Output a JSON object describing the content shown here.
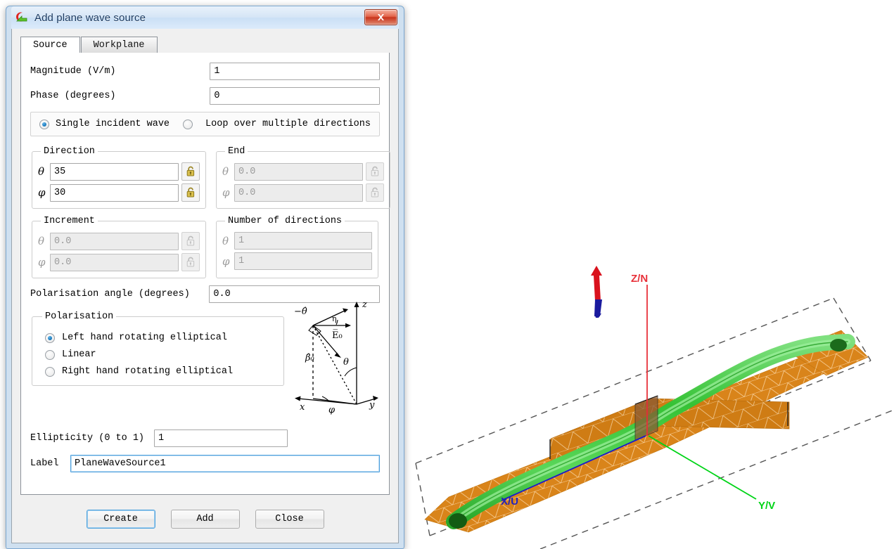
{
  "window": {
    "title": "Add plane wave source",
    "icon": "app-icon",
    "close_label": "close-icon"
  },
  "tabs": [
    {
      "label": "Source",
      "active": true
    },
    {
      "label": "Workplane",
      "active": false
    }
  ],
  "source": {
    "magnitude": {
      "label": "Magnitude (V/m)",
      "value": "1"
    },
    "phase": {
      "label": "Phase (degrees)",
      "value": "0"
    },
    "wave_mode": {
      "single": {
        "label": "Single incident wave",
        "selected": true
      },
      "loop": {
        "label": "Loop over multiple directions",
        "selected": false
      }
    },
    "direction": {
      "legend": "Direction",
      "theta_symbol": "θ",
      "phi_symbol": "φ",
      "theta": "35",
      "phi": "30",
      "lock_icon": "unlock-icon",
      "enabled": true
    },
    "end": {
      "legend": "End",
      "theta_symbol": "θ",
      "phi_symbol": "φ",
      "theta": "0.0",
      "phi": "0.0",
      "lock_icon": "unlock-icon",
      "enabled": false
    },
    "increment": {
      "legend": "Increment",
      "theta_symbol": "θ",
      "phi_symbol": "φ",
      "theta": "0.0",
      "phi": "0.0",
      "lock_icon": "unlock-icon",
      "enabled": false
    },
    "number_of_directions": {
      "legend": "Number of directions",
      "theta_symbol": "θ",
      "phi_symbol": "φ",
      "theta": "1",
      "phi": "1",
      "enabled": false
    },
    "polarisation_angle": {
      "label": "Polarisation angle (degrees)",
      "value": "0.0"
    },
    "polarisation": {
      "legend": "Polarisation",
      "options": [
        {
          "label": "Left hand rotating elliptical",
          "selected": true
        },
        {
          "label": "Linear",
          "selected": false
        },
        {
          "label": "Right hand rotating elliptical",
          "selected": false
        }
      ]
    },
    "figure": {
      "name": "polarisation-axes-figure",
      "labels": {
        "minus_theta_hat": "-θ̂",
        "eta": "η",
        "e_zero": "E̅₀",
        "beta_hat": "β̂₀",
        "theta": "θ",
        "phi": "φ",
        "x": "x",
        "y": "y",
        "z": "z"
      }
    },
    "ellipticity": {
      "label": "Ellipticity (0 to 1)",
      "value": "1"
    },
    "label_field": {
      "label": "Label",
      "value": "PlaneWaveSource1",
      "focused": true
    }
  },
  "buttons": [
    {
      "label": "Create",
      "default": true
    },
    {
      "label": "Add",
      "default": false
    },
    {
      "label": "Close",
      "default": false
    }
  ],
  "viewport": {
    "name": "model-3d-view",
    "axes": [
      {
        "label": "Z/N",
        "color": "#e8313a"
      },
      {
        "label": "Y/V",
        "color": "#00d417"
      },
      {
        "label": "X/U",
        "color": "#1a1acc"
      }
    ],
    "model": {
      "substrate_color": "#d9841a",
      "mesh_color": "#ffe0b0",
      "waveguide_color": "#45d045",
      "incident_arrow": {
        "top_color": "#d9121d",
        "bottom_color": "#1a1a9e"
      },
      "boundary_style": "dashed"
    }
  }
}
